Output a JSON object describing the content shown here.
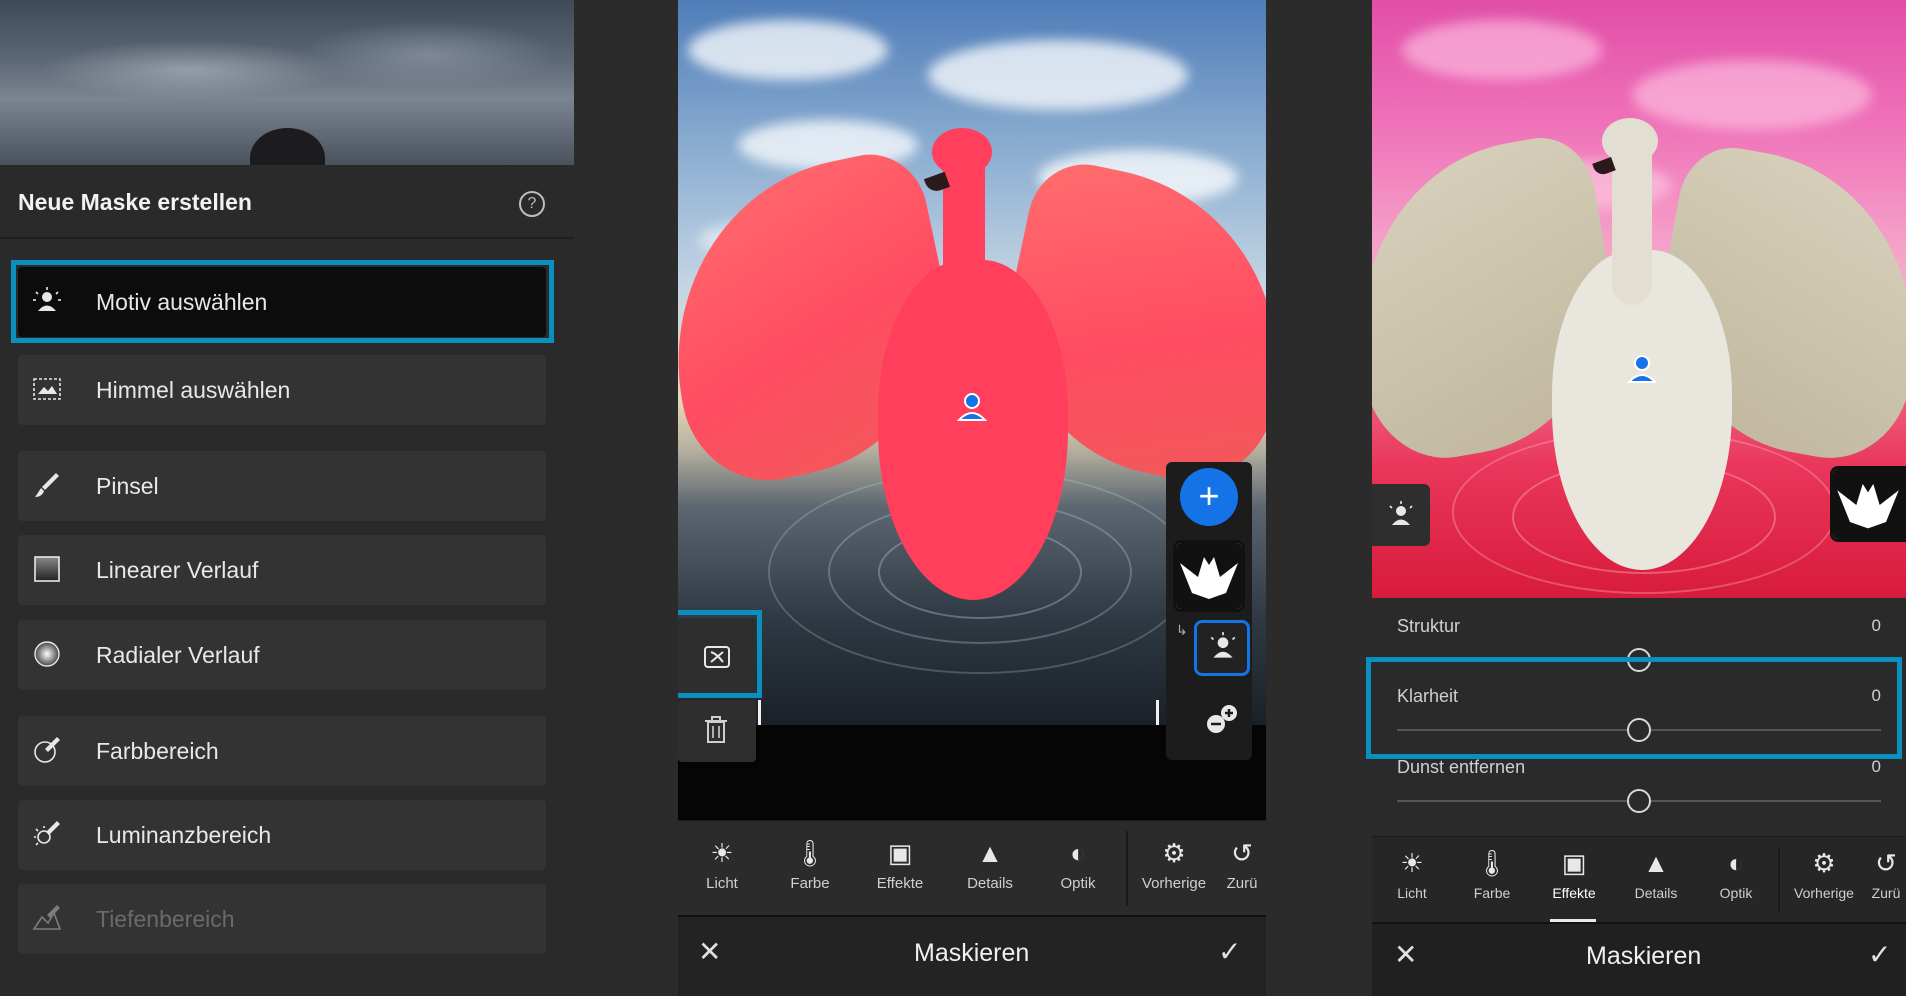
{
  "left": {
    "title": "Neue Maske erstellen",
    "help_icon": "help-circle-icon",
    "items": [
      {
        "label": "Motiv auswählen",
        "icon": "select-subject-icon",
        "state": "selected"
      },
      {
        "label": "Himmel auswählen",
        "icon": "select-sky-icon",
        "state": "normal"
      },
      {
        "label": "Pinsel",
        "icon": "brush-icon",
        "state": "normal"
      },
      {
        "label": "Linearer Verlauf",
        "icon": "linear-gradient-icon",
        "state": "normal"
      },
      {
        "label": "Radialer Verlauf",
        "icon": "radial-gradient-icon",
        "state": "normal"
      },
      {
        "label": "Farbbereich",
        "icon": "color-range-icon",
        "state": "normal"
      },
      {
        "label": "Luminanzbereich",
        "icon": "luminance-range-icon",
        "state": "normal"
      },
      {
        "label": "Tiefenbereich",
        "icon": "depth-range-icon",
        "state": "disabled"
      }
    ]
  },
  "middle": {
    "tools": [
      {
        "label": "Licht",
        "icon": "sun-icon"
      },
      {
        "label": "Farbe",
        "icon": "thermometer-icon"
      },
      {
        "label": "Effekte",
        "icon": "vignette-icon"
      },
      {
        "label": "Details",
        "icon": "triangle-icon"
      },
      {
        "label": "Optik",
        "icon": "lens-icon"
      },
      {
        "label": "Vorherige",
        "icon": "presets-icon"
      },
      {
        "label": "Zurü",
        "icon": "undo-icon"
      }
    ],
    "bottom_title": "Maskieren",
    "close_icon": "close-icon",
    "confirm_icon": "check-icon"
  },
  "right": {
    "sliders": [
      {
        "label": "Struktur",
        "value": "0"
      },
      {
        "label": "Klarheit",
        "value": "0"
      },
      {
        "label": "Dunst entfernen",
        "value": "0"
      }
    ],
    "tools": [
      {
        "label": "Licht",
        "icon": "sun-icon"
      },
      {
        "label": "Farbe",
        "icon": "thermometer-icon"
      },
      {
        "label": "Effekte",
        "icon": "vignette-icon"
      },
      {
        "label": "Details",
        "icon": "triangle-icon"
      },
      {
        "label": "Optik",
        "icon": "lens-icon"
      },
      {
        "label": "Vorherige",
        "icon": "presets-icon"
      },
      {
        "label": "Zurü",
        "icon": "undo-icon"
      }
    ],
    "active_tool": "Effekte",
    "bottom_title": "Maskieren"
  },
  "colors": {
    "highlight_frame": "#0a8fbf",
    "mask_overlay": "#ff3f5c",
    "add_button": "#1473e6"
  }
}
